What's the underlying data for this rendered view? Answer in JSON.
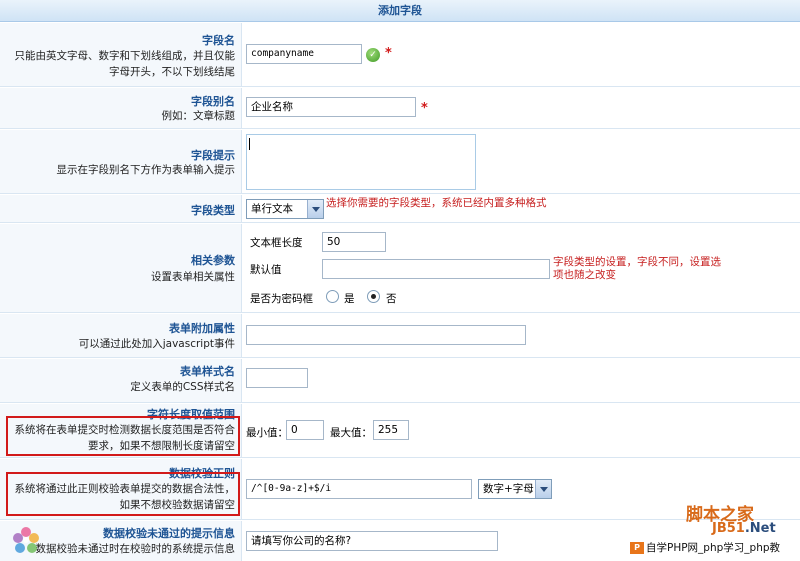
{
  "title": "添加字段",
  "fields": {
    "name": {
      "label": "字段名",
      "desc1": "只能由英文字母、数字和下划线组成，并且仅能",
      "desc2": "字母开头，不以下划线结尾",
      "value": "companyname",
      "required": "*"
    },
    "alias": {
      "label": "字段别名",
      "desc": "例如：文章标题",
      "value": "企业名称",
      "required": "*"
    },
    "tip": {
      "label": "字段提示",
      "desc": "显示在字段别名下方作为表单输入提示",
      "value": ""
    },
    "type": {
      "label": "字段类型",
      "selected": "单行文本",
      "hint": "选择你需要的字段类型，系统已经内置多种格式"
    },
    "params": {
      "label": "相关参数",
      "desc": "设置表单相关属性",
      "size_label": "文本框长度",
      "size_value": "50",
      "default_label": "默认值",
      "default_value": "",
      "password_label": "是否为密码框",
      "yes": "是",
      "no": "否",
      "hint1": "字段类型的设置，字段不同，设置选",
      "hint2": "项也随之改变"
    },
    "attr": {
      "label": "表单附加属性",
      "desc": "可以通过此处加入javascript事件",
      "value": ""
    },
    "css": {
      "label": "表单样式名",
      "desc": "定义表单的CSS样式名",
      "value": ""
    },
    "length": {
      "label": "字符长度取值范围",
      "desc1": "系统将在表单提交时检测数据长度范围是否符合",
      "desc2": "要求，如果不想限制长度请留空",
      "min_label": "最小值：",
      "min_value": "0",
      "max_label": "最大值：",
      "max_value": "255"
    },
    "regex": {
      "label": "数据校验正则",
      "desc1": "系统将通过此正则校验表单提交的数据合法性，",
      "desc2": "如果不想校验数据请留空",
      "value": "/^[0-9a-z]+$/i",
      "select": "数字+字母"
    },
    "error": {
      "label": "数据校验未通过的提示信息",
      "desc": "数据校验未通过时在校验时的系统提示信息",
      "value": "请填写你公司的名称?"
    }
  },
  "watermark": {
    "line1": "脚本之家",
    "line2a": "JB51",
    "line2b": ".Net",
    "line3": "自学PHP网_php学习_php教",
    "badge": "P"
  },
  "colors": {
    "label_blue": "#1e5494",
    "hint_red": "#c61e1e",
    "left_bg": "#f4f8fc"
  }
}
